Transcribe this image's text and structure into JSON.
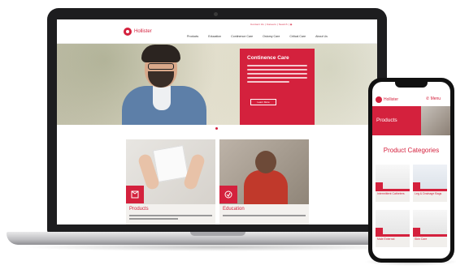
{
  "brand": {
    "accent": "#d4213d",
    "name": "Hollister"
  },
  "laptop": {
    "header": {
      "utility_links": "Contact Us | Careers | Search | ◉",
      "nav": [
        "Products",
        "Education",
        "Continence Care",
        "Ostomy Care",
        "Critical Care",
        "About Us"
      ]
    },
    "hero": {
      "title": "Continence Care",
      "button": "Learn More"
    },
    "cards": [
      {
        "title": "Products",
        "icon": "product-icon"
      },
      {
        "title": "Education",
        "icon": "education-icon"
      }
    ]
  },
  "phone": {
    "header_icons": "✆ Menu",
    "banner_title": "Products",
    "categories_title": "Product Categories",
    "tiles": [
      "Intermittent Catheters",
      "Leg & Drainage Bags",
      "Male External",
      "Skin Care"
    ]
  }
}
